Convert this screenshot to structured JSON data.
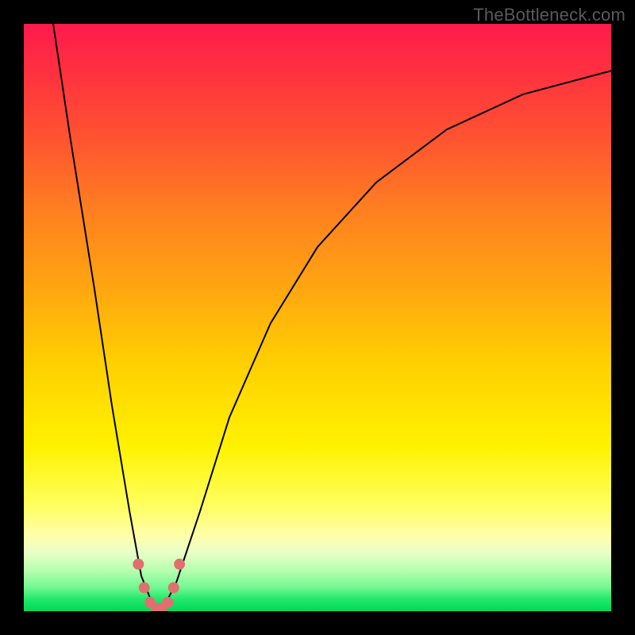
{
  "watermark": {
    "text": "TheBottleneck.com"
  },
  "chart_data": {
    "type": "line",
    "title": "",
    "xlabel": "",
    "ylabel": "",
    "xlim": [
      0,
      100
    ],
    "ylim": [
      0,
      100
    ],
    "grid": false,
    "legend": false,
    "background_gradient": {
      "stops": [
        {
          "pos": 0.0,
          "color": "#ff1a4d"
        },
        {
          "pos": 0.5,
          "color": "#ffb000"
        },
        {
          "pos": 0.82,
          "color": "#ffff60"
        },
        {
          "pos": 1.0,
          "color": "#00d858"
        }
      ]
    },
    "series": [
      {
        "name": "bottleneck-curve",
        "x": [
          5,
          8,
          12,
          15,
          18,
          20,
          22,
          23,
          24,
          26,
          30,
          35,
          42,
          50,
          60,
          72,
          85,
          100
        ],
        "y": [
          100,
          80,
          55,
          35,
          17,
          6,
          1,
          0,
          1,
          5,
          17,
          33,
          49,
          62,
          73,
          82,
          88,
          92
        ],
        "color": "#000000",
        "stroke_width": 2
      }
    ],
    "markers": {
      "name": "highlight-points",
      "color": "#e07070",
      "radius_px": 7,
      "points": [
        {
          "x": 19.5,
          "y": 8
        },
        {
          "x": 20.5,
          "y": 4
        },
        {
          "x": 21.5,
          "y": 1.5
        },
        {
          "x": 22.5,
          "y": 0.5
        },
        {
          "x": 23.5,
          "y": 0.5
        },
        {
          "x": 24.5,
          "y": 1.5
        },
        {
          "x": 25.5,
          "y": 4
        },
        {
          "x": 26.5,
          "y": 8
        }
      ]
    },
    "minimum": {
      "x": 23,
      "y": 0
    }
  }
}
